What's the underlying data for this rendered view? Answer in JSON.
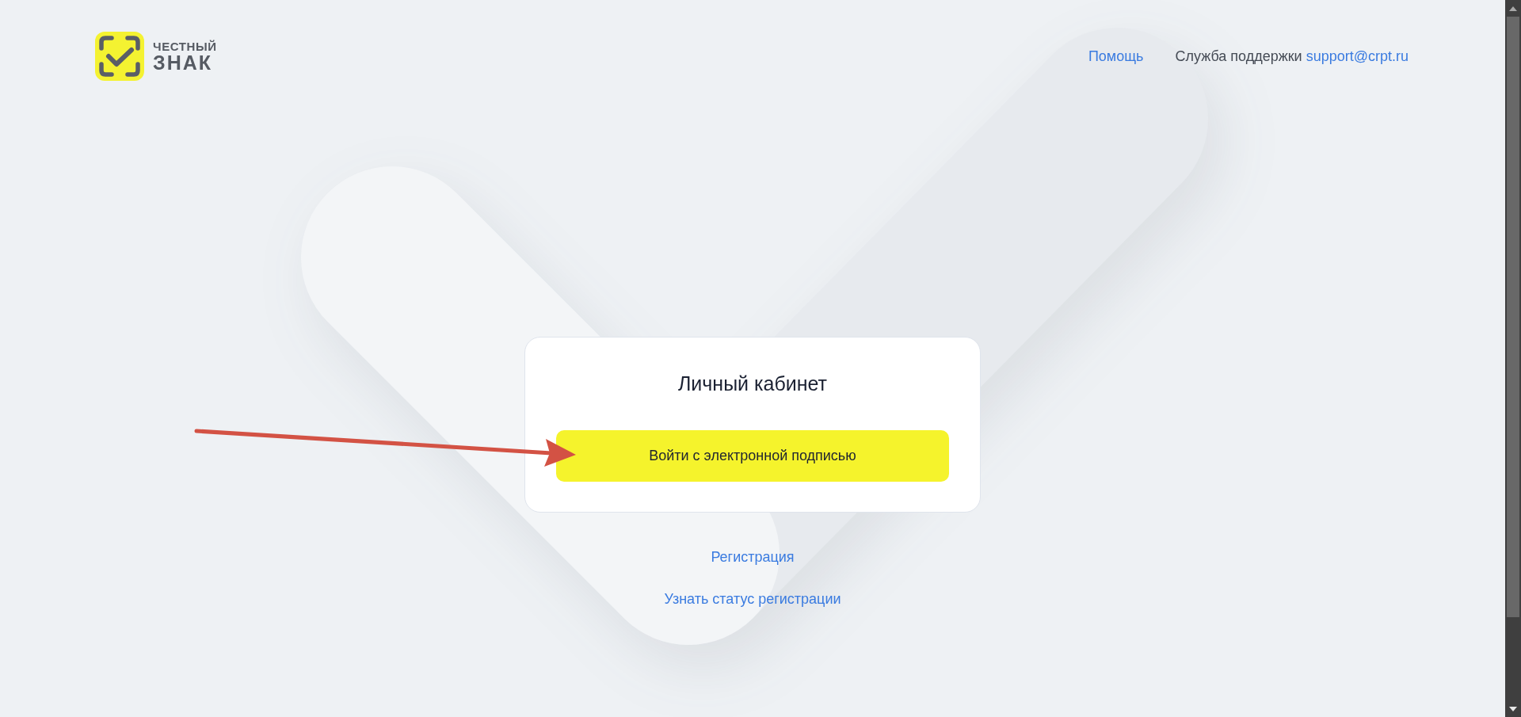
{
  "header": {
    "logo": {
      "line_1": "ЧЕСТНЫЙ",
      "line_2": "ЗНАК"
    },
    "help_link": "Помощь",
    "support": {
      "label": "Служба поддержки",
      "email": "support@crpt.ru"
    }
  },
  "login_card": {
    "title": "Личный кабинет",
    "button": "Войти с электронной подписью"
  },
  "links": [
    "Регистрация",
    "Узнать статус регистрации"
  ]
}
